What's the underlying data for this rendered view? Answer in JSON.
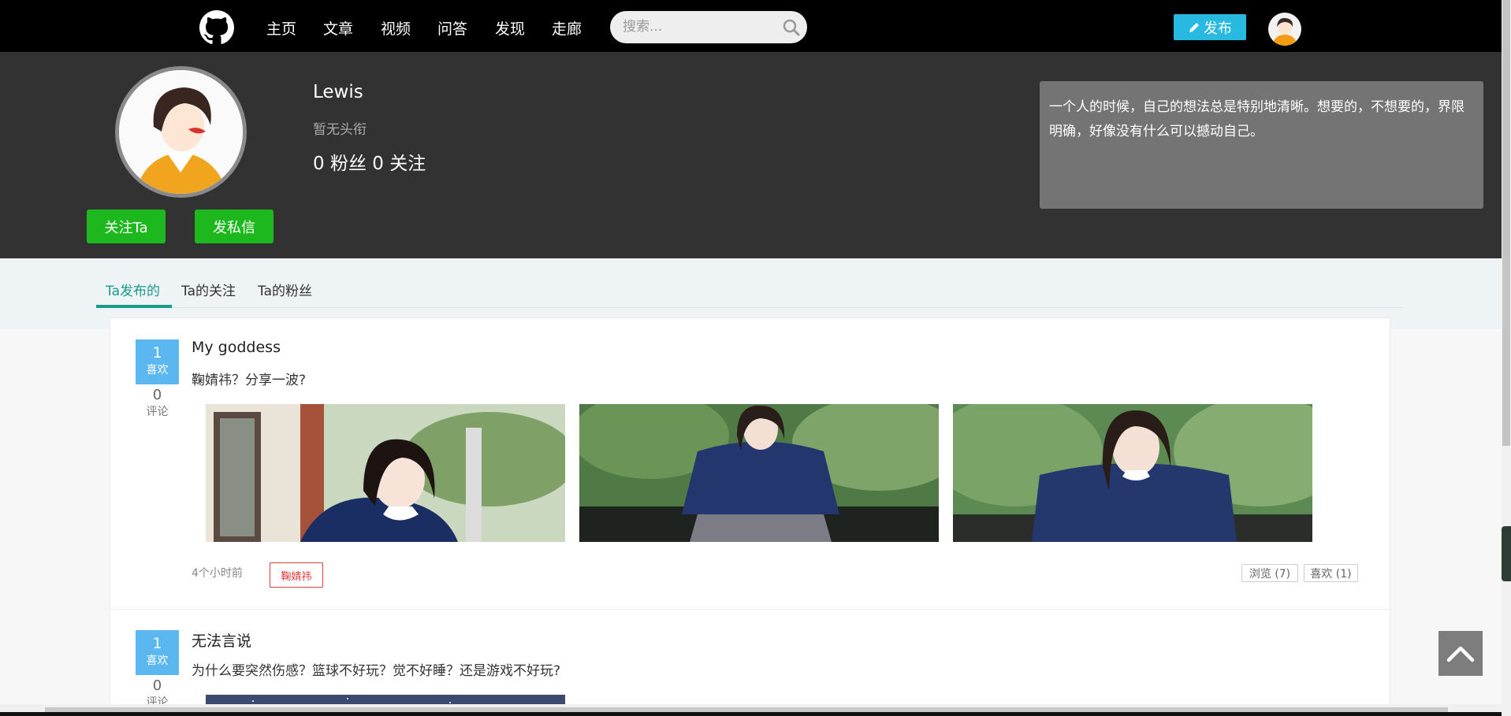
{
  "nav": {
    "logo_icon": "github-octocat-icon",
    "items": [
      {
        "label": "主页"
      },
      {
        "label": "文章"
      },
      {
        "label": "视频"
      },
      {
        "label": "问答"
      },
      {
        "label": "发现"
      },
      {
        "label": "走廊"
      }
    ],
    "search_placeholder": "搜索...",
    "search_icon": "search-icon",
    "publish_label": "发布",
    "publish_icon": "pencil-icon",
    "accent_color": "#27b9e0"
  },
  "profile": {
    "username": "Lewis",
    "title": "暂无头衔",
    "stats": "0 粉丝 0 关注",
    "follow_button": "关注Ta",
    "message_button": "发私信",
    "bio": "一个人的时候，自己的想法总是特别地清晰。想要的，不想要的，界限明确，好像没有什么可以撼动自己。",
    "button_color": "#1db81d"
  },
  "tabs": [
    {
      "label": "Ta发布的",
      "active": true
    },
    {
      "label": "Ta的关注",
      "active": false
    },
    {
      "label": "Ta的粉丝",
      "active": false
    }
  ],
  "posts": [
    {
      "likes": "1",
      "likes_label": "喜欢",
      "comments": "0",
      "comments_label": "评论",
      "title": "My goddess",
      "desc": "鞠婧祎？分享一波?",
      "time": "4个小时前",
      "tag": "鞠婧祎",
      "views_label": "浏览 (7)",
      "likes_btn_label": "喜欢 (1)"
    },
    {
      "likes": "1",
      "likes_label": "喜欢",
      "comments": "0",
      "comments_label": "评论",
      "title": "无法言说",
      "desc": "为什么要突然伤感？篮球不好玩？觉不好睡？还是游戏不好玩?"
    }
  ],
  "back_to_top_icon": "chevron-up-icon"
}
